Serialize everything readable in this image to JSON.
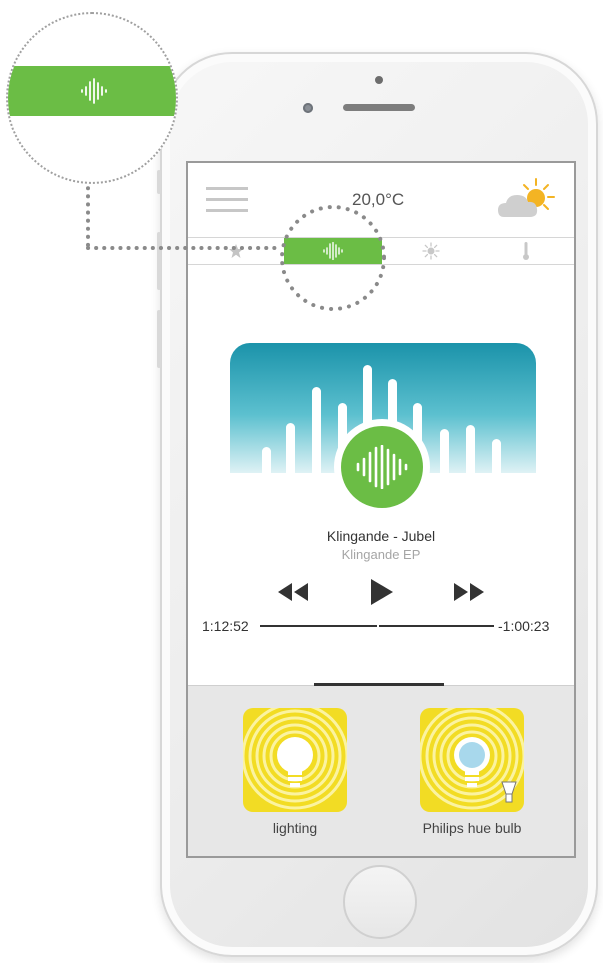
{
  "weather": {
    "temperature": "20,0°C",
    "icon": "partly-cloudy-icon"
  },
  "tabs": [
    {
      "icon": "star-icon",
      "active": false
    },
    {
      "icon": "sound-wave-icon",
      "active": true
    },
    {
      "icon": "sun-icon",
      "active": false
    },
    {
      "icon": "thermometer-icon",
      "active": false
    }
  ],
  "player": {
    "title": "Klingande - Jubel",
    "album": "Klingande EP",
    "elapsed": "1:12:52",
    "remaining": "-1:00:23",
    "progress": 0.5
  },
  "devices": [
    {
      "label": "lighting",
      "icon": "bulb-icon"
    },
    {
      "label": "Philips hue bulb",
      "icon": "hue-bulb-icon"
    }
  ],
  "colors": {
    "accent": "#6bbd45",
    "tile": "#f2dc24",
    "album_top": "#1b93aa",
    "album_bottom": "#dff2f5"
  }
}
